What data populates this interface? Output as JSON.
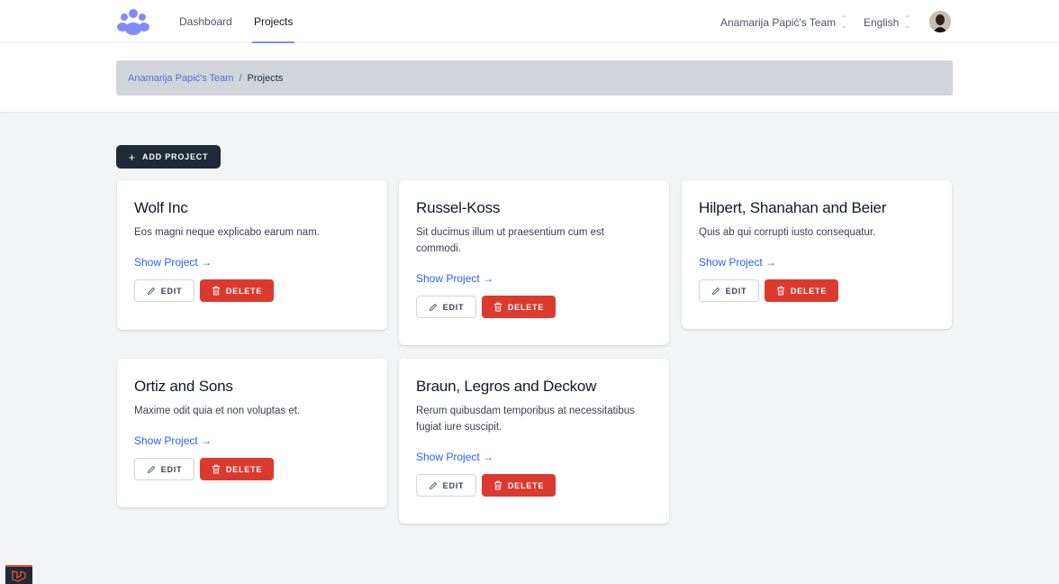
{
  "colors": {
    "brand": "#818cf8",
    "primary_button": "#1f2937",
    "danger": "#dc3a2f",
    "link": "#2563eb",
    "breadcrumb_bg": "#d1d5db",
    "page_bg": "#f3f4f6"
  },
  "nav": {
    "logo_icon": "team-people-icon",
    "links": [
      {
        "label": "Dashboard",
        "active": false
      },
      {
        "label": "Projects",
        "active": true
      }
    ],
    "team_selector": "Anamarija Papić's Team",
    "language_selector": "English",
    "avatar_icon": "user-avatar"
  },
  "breadcrumb": {
    "team": "Anamarija Papić's Team",
    "separator": "/",
    "current": "Projects"
  },
  "add_button": {
    "icon": "plus-icon",
    "label": "ADD PROJECT"
  },
  "card_labels": {
    "show": "Show Project →",
    "edit": "EDIT",
    "edit_icon": "pencil-icon",
    "delete": "DELETE",
    "delete_icon": "trash-icon"
  },
  "projects": [
    {
      "title": "Wolf Inc",
      "description": "Eos magni neque explicabo earum nam."
    },
    {
      "title": "Russel-Koss",
      "description": "Sit ducimus illum ut praesentium cum est commodi."
    },
    {
      "title": "Hilpert, Shanahan and Beier",
      "description": "Quis ab qui corrupti iusto consequatur."
    },
    {
      "title": "Ortiz and Sons",
      "description": "Maxime odit quia et non voluptas et."
    },
    {
      "title": "Braun, Legros and Deckow",
      "description": "Rerum quibusdam temporibus at necessitatibus fugiat iure suscipit."
    }
  ],
  "corner_badge_icon": "laravel-logo-icon"
}
